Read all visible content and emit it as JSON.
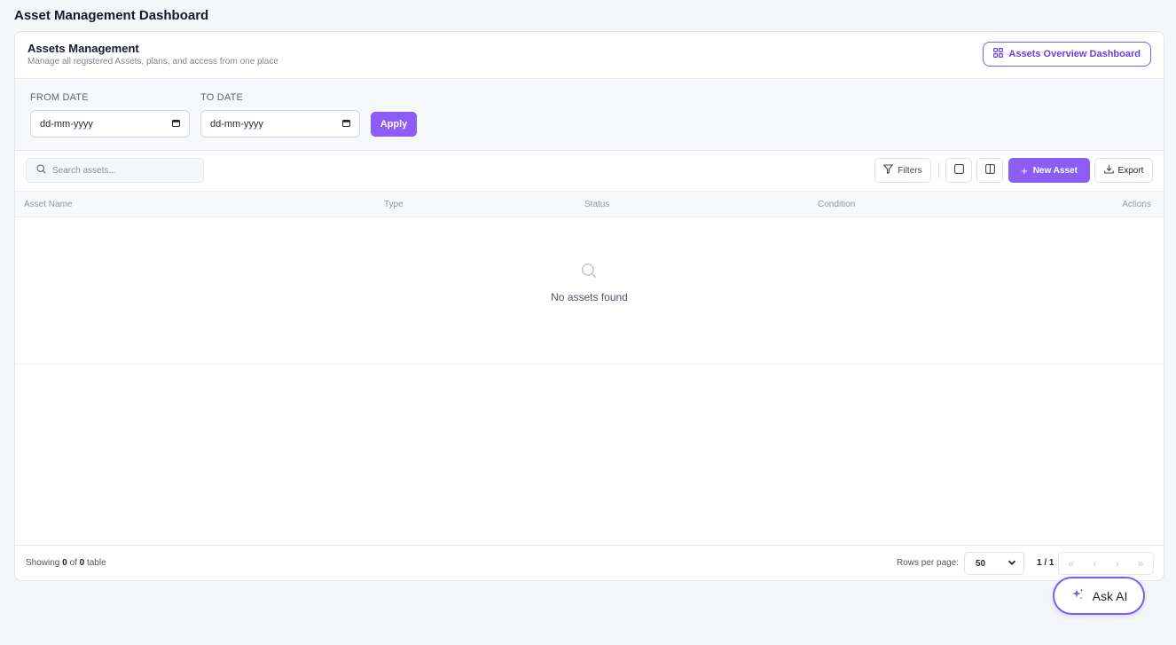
{
  "page": {
    "title": "Asset Management Dashboard"
  },
  "card": {
    "title": "Assets Management",
    "subtitle": "Manage all registered Assets, plans, and access from one place",
    "overview_button": "Assets Overview Dashboard"
  },
  "filters": {
    "from_label": "FROM DATE",
    "to_label": "TO DATE",
    "from_value": "dd-mm-yyyy",
    "to_value": "dd-mm-yyyy",
    "apply_label": "Apply"
  },
  "toolbar": {
    "search_placeholder": "Search assets...",
    "filters_label": "Filters",
    "new_asset_label": "New Asset",
    "export_label": "Export"
  },
  "table": {
    "columns": [
      "Asset Name",
      "Type",
      "Status",
      "Condition",
      "Actions"
    ],
    "empty_text": "No assets found"
  },
  "footer": {
    "showing_prefix": "Showing",
    "showing_count": "0",
    "showing_of": "of",
    "showing_total": "0",
    "showing_suffix": "table",
    "rows_per_page_label": "Rows per page:",
    "rows_per_page_value": "50",
    "page_info": "1 / 1",
    "pager": {
      "first": "«",
      "prev": "‹",
      "next": "›",
      "last": "»"
    }
  },
  "ask_ai": {
    "label": "Ask AI"
  },
  "colors": {
    "accent": "#8b5cf6",
    "accent_border": "#7c5cf0",
    "background": "#f5f6fa"
  }
}
